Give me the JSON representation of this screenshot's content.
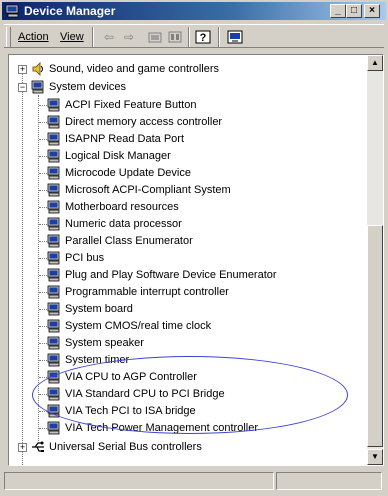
{
  "window": {
    "title": "Device Manager"
  },
  "titlebar_buttons": [
    "_",
    "□",
    "×"
  ],
  "menu": {
    "action": "Action",
    "view": "View"
  },
  "toolbar": {
    "icons": [
      "back-icon",
      "forward-icon",
      "up-folder-icon",
      "properties-icon",
      "help-icon",
      "refresh-icon"
    ],
    "back": "⇦",
    "forward": "⇨"
  },
  "tree": {
    "sound": "Sound, video and game controllers",
    "system_devices": "System devices",
    "children": [
      "ACPI Fixed Feature Button",
      "Direct memory access controller",
      "ISAPNP Read Data Port",
      "Logical Disk Manager",
      "Microcode Update Device",
      "Microsoft ACPI-Compliant System",
      "Motherboard resources",
      "Numeric data processor",
      "Parallel Class Enumerator",
      "PCI bus",
      "Plug and Play Software Device Enumerator",
      "Programmable interrupt controller",
      "System board",
      "System CMOS/real time clock",
      "System speaker",
      "System timer",
      "VIA CPU to AGP Controller",
      "VIA Standard CPU to PCI Bridge",
      "VIA Tech PCI to ISA bridge",
      "VIA Tech Power Management controller"
    ],
    "usb": "Universal Serial Bus controllers"
  },
  "expander": {
    "collapsed": "+",
    "expanded": "−"
  },
  "scrollbar": {
    "up": "▲",
    "down": "▼"
  },
  "colors": {
    "title_start": "#0a246a",
    "title_end": "#a6caf0",
    "highlight_oval": "#3a44d0",
    "device_icon": "#1c3ea8"
  }
}
